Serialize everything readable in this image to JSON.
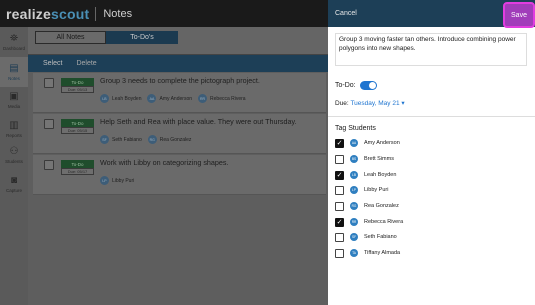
{
  "app": {
    "brand_part1": "realize",
    "brand_part2": "scout",
    "section_title": "Notes"
  },
  "leftnav": {
    "items": [
      {
        "label": "Dashboard",
        "icon": "telescope-icon",
        "glyph": "⛯"
      },
      {
        "label": "Notes",
        "icon": "notes-icon",
        "glyph": "▤"
      },
      {
        "label": "Media",
        "icon": "media-icon",
        "glyph": "▣"
      },
      {
        "label": "Reports",
        "icon": "reports-icon",
        "glyph": "▥"
      },
      {
        "label": "Students",
        "icon": "students-icon",
        "glyph": "⚇"
      },
      {
        "label": "Capture",
        "icon": "camera-icon",
        "glyph": "◙"
      }
    ]
  },
  "tabs": {
    "all": "All Notes",
    "todo": "To-Do's"
  },
  "actions": {
    "select": "Select",
    "delete": "Delete"
  },
  "notes": [
    {
      "badge": "To-Do",
      "due": "Due: 05/13",
      "text": "Group 3 needs to complete the pictograph project.",
      "tags": [
        {
          "initials": "LB",
          "name": "Leah Boyden"
        },
        {
          "initials": "AA",
          "name": "Amy Anderson"
        },
        {
          "initials": "RR",
          "name": "Rebecca Rivera"
        }
      ]
    },
    {
      "badge": "To-Do",
      "due": "Due: 05/15",
      "text": "Help Seth and Rea with place value. They were out Thursday.",
      "tags": [
        {
          "initials": "SF",
          "name": "Seth Fabiano"
        },
        {
          "initials": "RG",
          "name": "Rea Gonzalez"
        }
      ]
    },
    {
      "badge": "To-Do",
      "due": "Due: 05/17",
      "text": "Work with Libby on categorizing shapes.",
      "tags": [
        {
          "initials": "LP",
          "name": "Libby Puri"
        }
      ]
    }
  ],
  "panel": {
    "cancel": "Cancel",
    "save": "Save",
    "description": "Group 3 moving faster tan others. Introduce combining power polygons into new shapes.",
    "todo_label": "To-Do:",
    "todo_on": true,
    "due_label": "Due:",
    "due_value": "Tuesday, May 21 ▾",
    "tag_title": "Tag Students",
    "students": [
      {
        "initials": "AA",
        "name": "Amy Anderson",
        "checked": true
      },
      {
        "initials": "BS",
        "name": "Brett Simms",
        "checked": false
      },
      {
        "initials": "LB",
        "name": "Leah Boyden",
        "checked": true
      },
      {
        "initials": "LP",
        "name": "Libby Puri",
        "checked": false
      },
      {
        "initials": "RG",
        "name": "Rea Gonzalez",
        "checked": false
      },
      {
        "initials": "RR",
        "name": "Rebecca Rivera",
        "checked": true
      },
      {
        "initials": "SF",
        "name": "Seth Fabiano",
        "checked": false
      },
      {
        "initials": "TA",
        "name": "Tiffany Almada",
        "checked": false
      }
    ]
  },
  "colors": {
    "accent": "#1f75d0",
    "header": "#1d3f57",
    "save_highlight": "#e13de0",
    "todo_badge": "#1f4d2c"
  }
}
